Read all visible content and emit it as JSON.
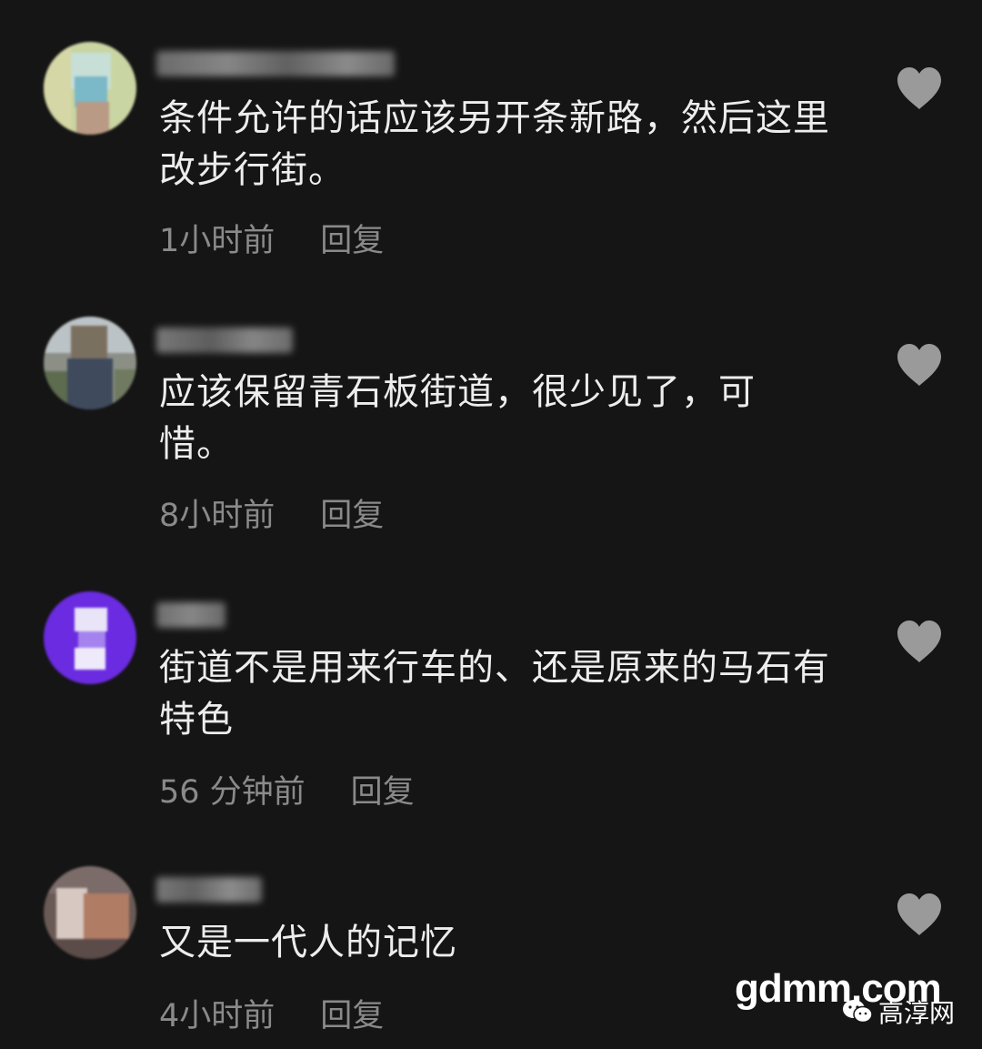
{
  "comments": [
    {
      "text": "条件允许的话应该另开条新路，然后这里改步行街。",
      "time": "1小时前",
      "reply_label": "回复"
    },
    {
      "text": "应该保留青石板街道，很少见了，可惜。",
      "time": "8小时前",
      "reply_label": "回复"
    },
    {
      "text": "街道不是用来行车的、还是原来的马石有特色",
      "time": "56 分钟前",
      "reply_label": "回复"
    },
    {
      "text": "又是一代人的记忆",
      "time": "4小时前",
      "reply_label": "回复"
    }
  ],
  "icons": {
    "like": "heart-icon",
    "avatar": "avatar-image",
    "watermark_logo": "wechat-icon"
  },
  "colors": {
    "background": "#151515",
    "text": "#ededed",
    "meta": "#8a8a8a",
    "heart": "#9a9a9a"
  },
  "watermark": {
    "site": "gdmm.com",
    "brand": "高淳网"
  }
}
